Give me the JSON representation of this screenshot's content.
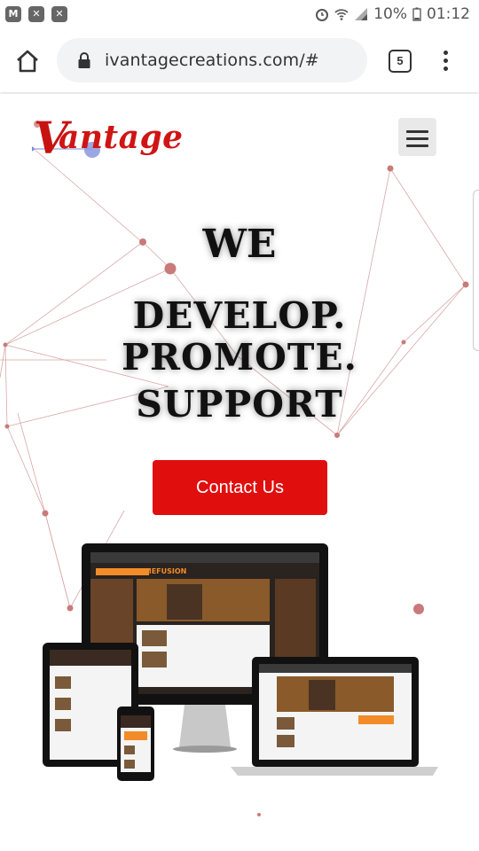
{
  "status_bar": {
    "battery_percent": "10%",
    "time": "01:12",
    "left_icons": [
      "m-app-icon",
      "cross-app-icon",
      "cross-app-icon"
    ],
    "right_icons": [
      "alarm-icon",
      "wifi-icon",
      "signal-icon",
      "battery-icon"
    ]
  },
  "browser": {
    "url": "ivantagecreations.com/#",
    "tab_count": "5"
  },
  "site": {
    "logo_text": "antage",
    "logo_initial": "V",
    "hero_we": "WE",
    "hero_lines": [
      "DEVELOP.",
      "PROMOTE.",
      "SUPPORT"
    ],
    "cta_label": "Contact Us",
    "device_mockup_brand": "GAMEFUSION"
  },
  "colors": {
    "brand_red": "#e10e0e",
    "logo_red": "#d01414",
    "network_line": "#c97a7a"
  }
}
